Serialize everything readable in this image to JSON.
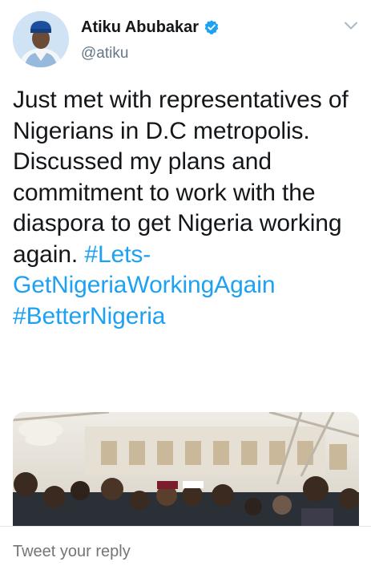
{
  "tweet": {
    "author": {
      "display_name": "Atiku Abubakar",
      "handle": "@atiku",
      "verified": true,
      "verified_icon": "verified-badge-icon"
    },
    "text_parts": [
      "Just met with representatives of Nigerians in D.C metropolis. Discussed my plans and commitment to work with the diaspora to get Nigeria working again. ",
      "#Lets-GetNigeriaWorkingAgain",
      " ",
      "#BetterNigeria"
    ],
    "media": {
      "type": "photo"
    }
  },
  "reply": {
    "placeholder": "Tweet your reply"
  },
  "colors": {
    "link": "#1da1f2",
    "text": "#14171a",
    "secondary": "#657786",
    "border": "#e1e8ed"
  }
}
